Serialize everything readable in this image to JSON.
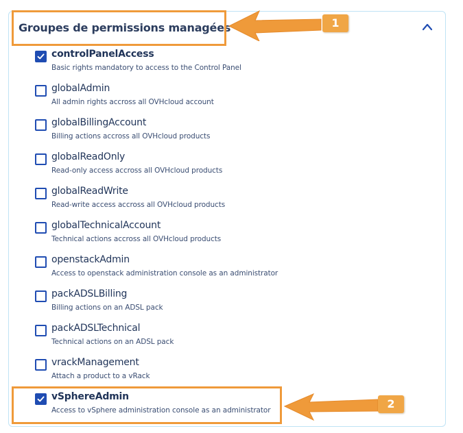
{
  "panel": {
    "title": "Groupes de permissions managées",
    "items": [
      {
        "name": "controlPanelAccess",
        "description": "Basic rights mandatory to access to the Control Panel",
        "checked": true
      },
      {
        "name": "globalAdmin",
        "description": "All admin rights accross all OVHcloud account",
        "checked": false
      },
      {
        "name": "globalBillingAccount",
        "description": "Billing actions accross all OVHcloud products",
        "checked": false
      },
      {
        "name": "globalReadOnly",
        "description": "Read-only access accross all OVHcloud products",
        "checked": false
      },
      {
        "name": "globalReadWrite",
        "description": "Read-write access accross all OVHcloud products",
        "checked": false
      },
      {
        "name": "globalTechnicalAccount",
        "description": "Technical actions accross all OVHcloud products",
        "checked": false
      },
      {
        "name": "openstackAdmin",
        "description": "Access to openstack administration console as an administrator",
        "checked": false
      },
      {
        "name": "packADSLBilling",
        "description": "Billing actions on an ADSL pack",
        "checked": false
      },
      {
        "name": "packADSLTechnical",
        "description": "Technical actions on an ADSL pack",
        "checked": false
      },
      {
        "name": "vrackManagement",
        "description": "Attach a product to a vRack",
        "checked": false
      },
      {
        "name": "vSphereAdmin",
        "description": "Access to vSphere administration console as an administrator",
        "checked": true
      }
    ]
  },
  "icons": {
    "collapse": "chevron-up-icon",
    "check": "check-icon"
  },
  "annotations": {
    "badge_1": "1",
    "badge_2": "2"
  },
  "colors": {
    "accent": "#1f4cb2",
    "callout": "#ef9a3a",
    "badge": "#f0a646",
    "panel_border": "#bfe3f5"
  }
}
